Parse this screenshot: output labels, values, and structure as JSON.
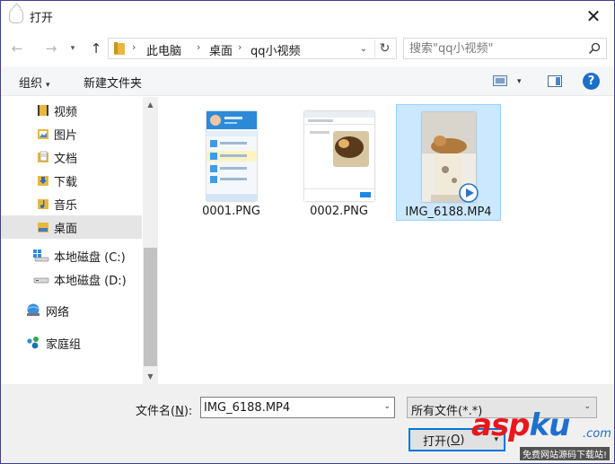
{
  "window": {
    "title": "打开",
    "close_glyph": "✕"
  },
  "nav": {
    "back_glyph": "←",
    "forward_glyph": "→",
    "recent_glyph": "▾",
    "up_glyph": "↑"
  },
  "address": {
    "sep": "›",
    "crumbs": [
      "此电脑",
      "桌面",
      "qq小视频"
    ],
    "dropdown_glyph": "⌄",
    "refresh_glyph": "↻"
  },
  "search": {
    "placeholder": "搜索\"qq小视频\""
  },
  "toolbar": {
    "organize_label": "组织",
    "organize_caret": "▾",
    "new_folder_label": "新建文件夹",
    "view_caret": "▾",
    "help_glyph": "?"
  },
  "navpane": {
    "items": [
      {
        "label": "视频",
        "icon": "video-folder-icon"
      },
      {
        "label": "图片",
        "icon": "pictures-folder-icon"
      },
      {
        "label": "文档",
        "icon": "documents-folder-icon"
      },
      {
        "label": "下载",
        "icon": "downloads-folder-icon"
      },
      {
        "label": "音乐",
        "icon": "music-folder-icon"
      },
      {
        "label": "桌面",
        "icon": "desktop-folder-icon",
        "selected": true
      },
      {
        "label": "本地磁盘 (C:)",
        "icon": "windows-drive-icon"
      },
      {
        "label": "本地磁盘 (D:)",
        "icon": "drive-icon"
      },
      {
        "label": "网络",
        "icon": "network-icon"
      },
      {
        "label": "家庭组",
        "icon": "homegroup-icon"
      }
    ],
    "scroll_up_glyph": "▲",
    "scroll_down_glyph": "▼"
  },
  "files": [
    {
      "name": "0001.PNG",
      "type": "png-screenshot"
    },
    {
      "name": "0002.PNG",
      "type": "png-screenshot"
    },
    {
      "name": "IMG_6188.MP4",
      "type": "video",
      "selected": true
    }
  ],
  "bottom": {
    "filename_label_prefix": "文件名(",
    "filename_label_key": "N",
    "filename_label_suffix": "):",
    "filename_value": "IMG_6188.MP4",
    "filename_caret": "⌄",
    "filetype_value": "所有文件(*.*)",
    "filetype_caret": "⌄",
    "open_prefix": "打开(",
    "open_key": "O",
    "open_suffix": ")",
    "open_caret": "▾"
  },
  "watermark": {
    "asp": "asp",
    "ku": "ku",
    "com": ".com",
    "sub": "免费网站源码下载站!"
  },
  "colors": {
    "accent": "#0078d7",
    "selection": "#cce8ff",
    "folder": "#e9b73c"
  }
}
